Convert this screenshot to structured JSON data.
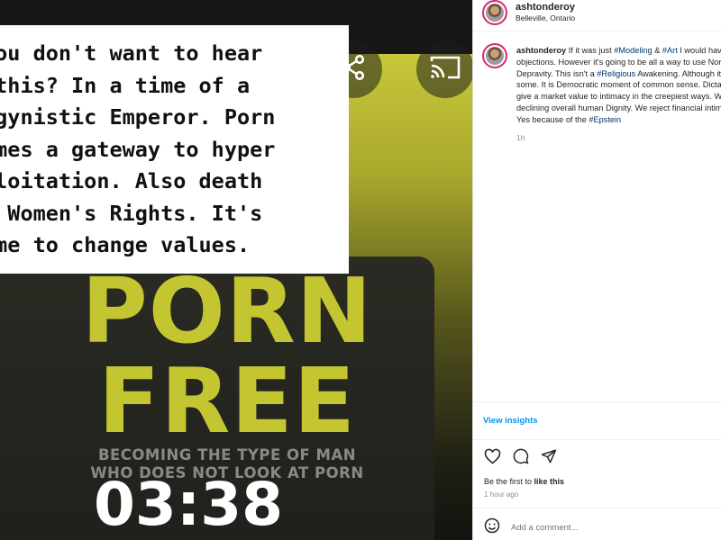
{
  "post": {
    "caption_overlay": "You don't want to hear\n this? In a time of a\nogynistic Emperor. Porn\nomes a gateway to hyper\nploitation. Also death\nf Women's Rights. It's\nime to change values.",
    "poster_line1": "PORN",
    "poster_line2": "FREE",
    "poster_sub1": "BECOMING THE TYPE OF MAN",
    "poster_sub2": "WHO DOES NOT LOOK AT PORN",
    "timer": "03:38",
    "icons": {
      "share": "share-icon",
      "cast": "cast-icon"
    }
  },
  "header": {
    "username": "ashtonderoy",
    "location": "Belleville, Ontario"
  },
  "caption": {
    "username": "ashtonderoy",
    "t1": " If it was just ",
    "tag1": "#Modeling",
    "t2": " & ",
    "tag2": "#Art",
    "t3": " I would have no objections. However it's going to be all a way to use Normalized Depravity. This isn't a ",
    "tag3": "#Religious",
    "t4": " Awakening. Although it is for some. It is Democratic moment of common sense. Dictatorships give a market value to intimacy in the creepiest ways. With a declining overall human Dignity. We reject financial intimacy. Yes because of the ",
    "tag4": "#Epstein",
    "time_ago": "1h"
  },
  "insights_label": "View insights",
  "likes": {
    "prefix": "Be the first to ",
    "bold": "like this"
  },
  "posted": "1 hour ago",
  "comment": {
    "placeholder": "Add a comment..."
  },
  "colors": {
    "link": "#00376b",
    "insights": "#0095f6",
    "poster_yellow": "#c4c631"
  }
}
